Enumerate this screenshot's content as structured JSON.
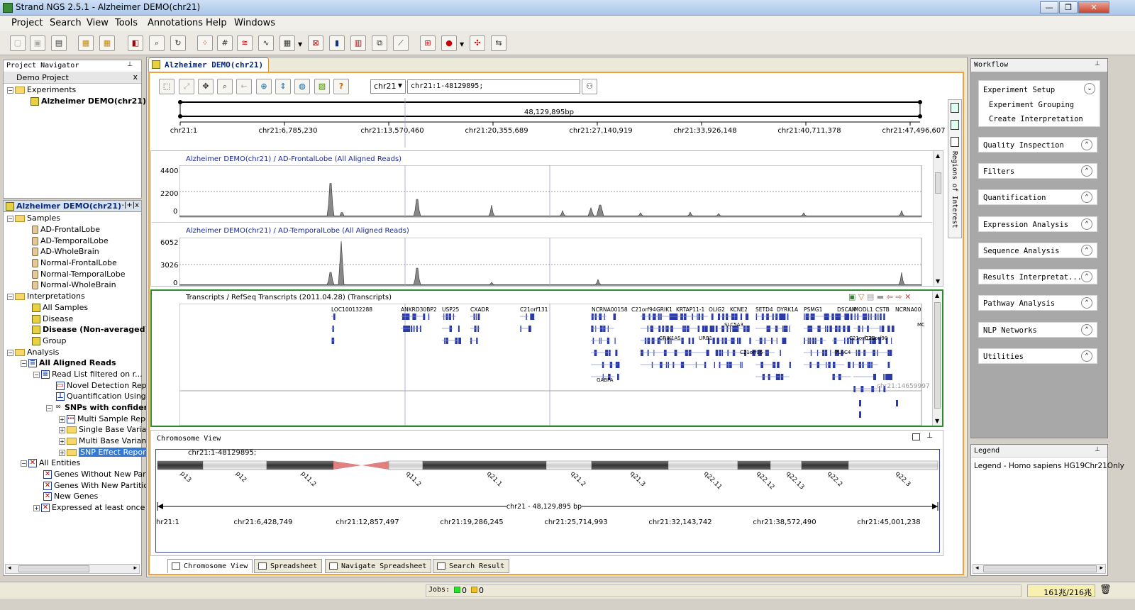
{
  "window": {
    "title": "Strand NGS 2.5.1 - Alzheimer DEMO(chr21)",
    "min": "—",
    "max": "❐",
    "close": "✕"
  },
  "menu": [
    "Project",
    "Search",
    "View",
    "Tools",
    "Annotations",
    "Help",
    "Windows"
  ],
  "navigator": {
    "title": "Project Navigator",
    "project": "Demo Project",
    "close": "x",
    "experiments_label": "Experiments",
    "experiment_item": "Alzheimer DEMO(chr21)"
  },
  "exp_tree": {
    "title": "Alzheimer DEMO(chr21)",
    "ctrls": "-|+|x",
    "samples_label": "Samples",
    "samples": [
      "AD-FrontalLobe",
      "AD-TemporalLobe",
      "AD-WholeBrain",
      "Normal-FrontalLobe",
      "Normal-TemporalLobe",
      "Normal-WholeBrain"
    ],
    "interpretations_label": "Interpretations",
    "interpretations": [
      "All Samples",
      "Disease",
      "Disease (Non-averaged)",
      "Group"
    ],
    "analysis_label": "Analysis",
    "all_aligned": "All Aligned Reads",
    "read_list": "Read List filtered on r...",
    "novel": "Novel Detection Repo",
    "quant": "Quantification Using K",
    "snps": "SNPs with confider",
    "snp_children": [
      "Multi Sample Repo",
      "Single Base Variar",
      "Multi Base Variant",
      "SNP Effect Repor"
    ],
    "entities_label": "All Entities",
    "entities": [
      "Genes Without New Parti",
      "Genes With New Partition",
      "New Genes",
      "Expressed at least once"
    ]
  },
  "doc": {
    "tab": "Alzheimer DEMO(chr21)",
    "chrom": "chr21",
    "locus": "chr21:1-48129895;"
  },
  "overview": {
    "span": "48,129,895bp",
    "ticks": [
      "chr21:1",
      "chr21:6,785,230",
      "chr21:13,570,460",
      "chr21:20,355,689",
      "chr21:27,140,919",
      "chr21:33,926,148",
      "chr21:40,711,378",
      "chr21:47,496,607"
    ]
  },
  "regions_label": "Regions of Interest",
  "track1": {
    "title": "Alzheimer DEMO(chr21) / AD-FrontalLobe (All Aligned Reads)",
    "y": [
      "4400",
      "2200",
      "0"
    ]
  },
  "track2": {
    "title": "Alzheimer DEMO(chr21) / AD-TemporalLobe (All Aligned Reads)",
    "y": [
      "6052",
      "3026",
      "0"
    ]
  },
  "transcripts": {
    "title": "Transcripts / RefSeq Transcripts (2011.04.28) (Transcripts)",
    "genes": [
      "LOC100132288",
      "ANKRD30BP2",
      "USP25",
      "CXADR",
      "C21orf131",
      "NCRNA00158",
      "C21orf94",
      "GRIK1",
      "KRTAP11-1",
      "OLIG2",
      "KCNE2",
      "SETD4",
      "DYRK1A",
      "PSMG1",
      "DSCAM",
      "UMODL1",
      "CSTB",
      "NCRNA00"
    ],
    "small": [
      "GRIK1AS",
      "URB1",
      "SLC5A3",
      "C21orf96",
      "PLAC4",
      "C21orf128",
      "C21orf90",
      "MC",
      "GABPA"
    ],
    "coord": "chr21:14659997"
  },
  "chromview": {
    "title": "Chromosome View",
    "locus": "chr21:1-48129895;",
    "bands": [
      "p13",
      "p12",
      "p11.2",
      "q11.2",
      "q21.1",
      "q21.2",
      "q21.3",
      "q22.11",
      "q22.12",
      "q22.13",
      "q22.2",
      "q22.3"
    ],
    "span": "chr21 - 48,129,895 bp",
    "ticks": [
      "hr21:1",
      "chr21:6,428,749",
      "chr21:12,857,497",
      "chr21:19,286,245",
      "chr21:25,714,993",
      "chr21:32,143,742",
      "chr21:38,572,490",
      "chr21:45,001,238"
    ]
  },
  "bottom_tabs": [
    "Chromosome View",
    "Spreadsheet",
    "Navigate Spreadsheet",
    "Search Result"
  ],
  "workflow": {
    "title": "Workflow",
    "setup": "Experiment Setup",
    "setup_items": [
      "Experiment Grouping",
      "Create Interpretation"
    ],
    "sections": [
      "Quality Inspection",
      "Filters",
      "Quantification",
      "Expression Analysis",
      "Sequence Analysis",
      "Results Interpretat...",
      "Pathway Analysis",
      "NLP Networks",
      "Utilities"
    ]
  },
  "legend": {
    "title": "Legend",
    "text": "Legend - Homo sapiens HG19Chr21Only"
  },
  "status": {
    "jobs": "Jobs:",
    "green": "0",
    "yellow": "0",
    "memory": "161兆/216兆"
  }
}
